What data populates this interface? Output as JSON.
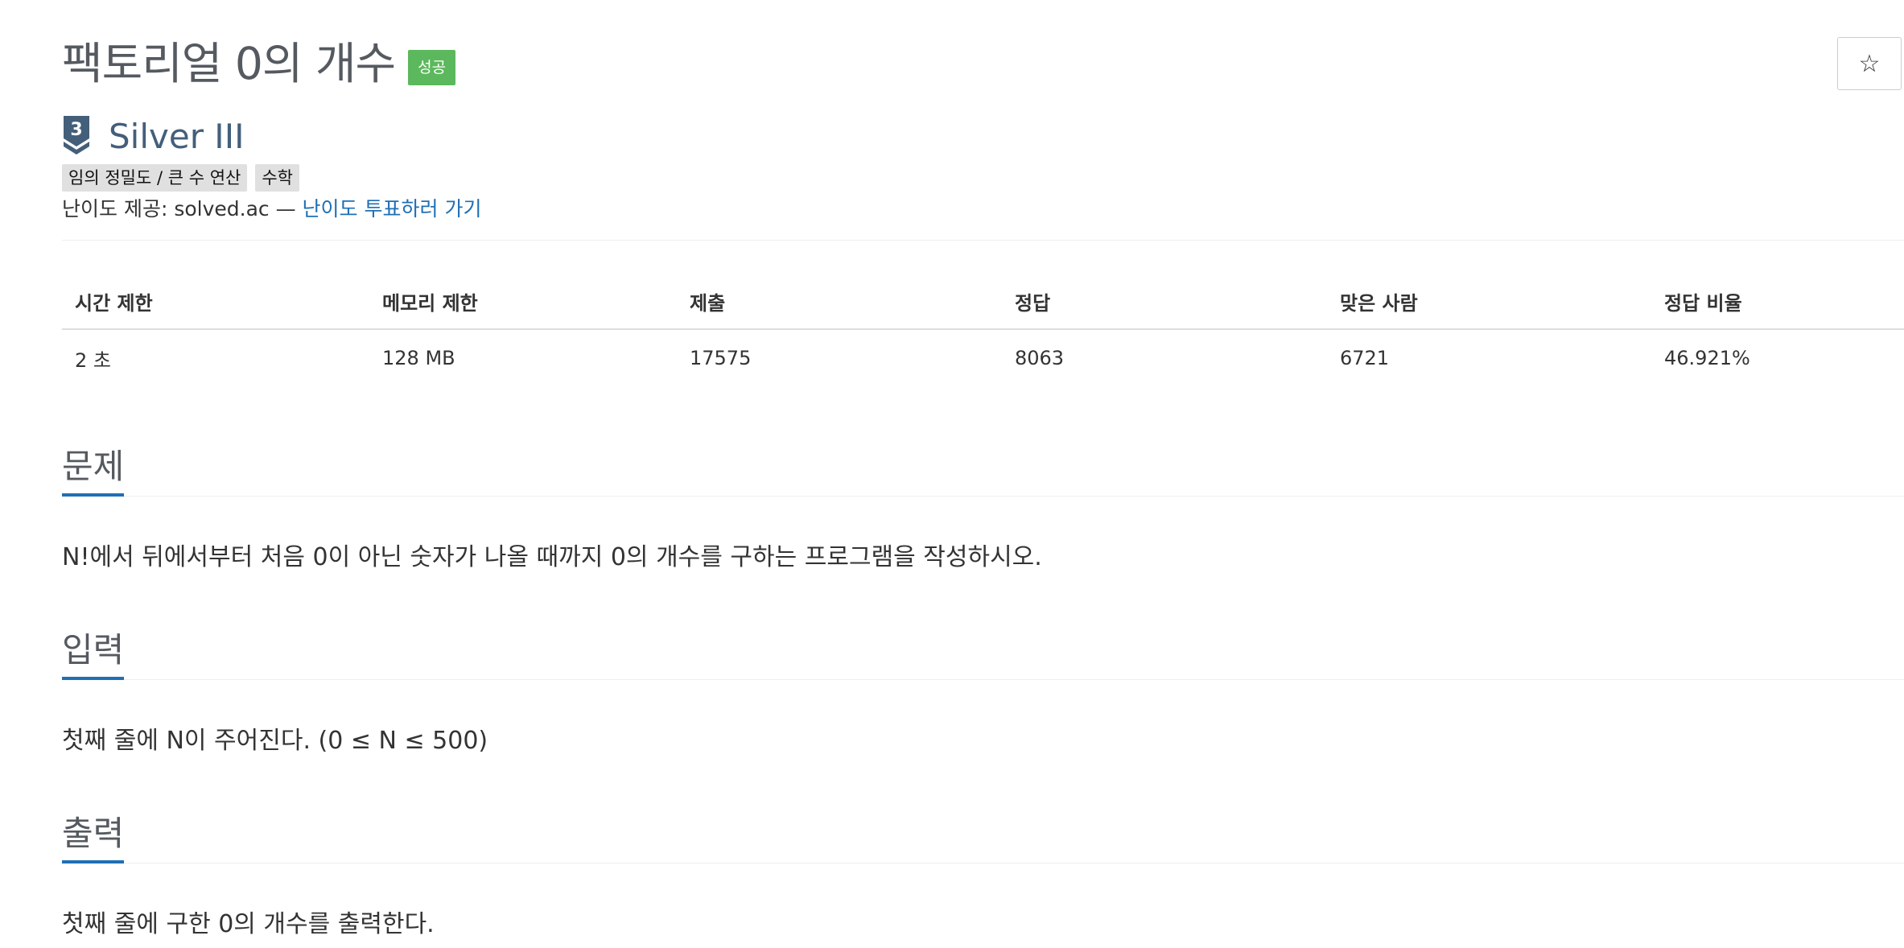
{
  "problem": {
    "title": "팩토리얼 0의 개수",
    "result_badge": "성공",
    "star_glyph": "☆",
    "tier_level": "3",
    "tier_name": "Silver III",
    "tier_color": "#435f7a",
    "tags": [
      "임의 정밀도 / 큰 수 연산",
      "수학"
    ],
    "difficulty_prefix": "난이도 제공: solved.ac — ",
    "difficulty_vote_link": "난이도 투표하러 가기"
  },
  "info_table": {
    "headers": [
      "시간 제한",
      "메모리 제한",
      "제출",
      "정답",
      "맞은 사람",
      "정답 비율"
    ],
    "row": [
      "2 초",
      "128 MB",
      "17575",
      "8063",
      "6721",
      "46.921%"
    ]
  },
  "sections": [
    {
      "heading": "문제",
      "body": "N!에서 뒤에서부터 처음 0이 아닌 숫자가 나올 때까지 0의 개수를 구하는 프로그램을 작성하시오."
    },
    {
      "heading": "입력",
      "body": "첫째 줄에 N이 주어진다. (0 ≤ N ≤ 500)"
    },
    {
      "heading": "출력",
      "body": "첫째 줄에 구한 0의 개수를 출력한다."
    }
  ],
  "colors": {
    "accent": "#1f6fb5",
    "success": "#5cb85c",
    "tag_bg": "#e0e0e0"
  }
}
